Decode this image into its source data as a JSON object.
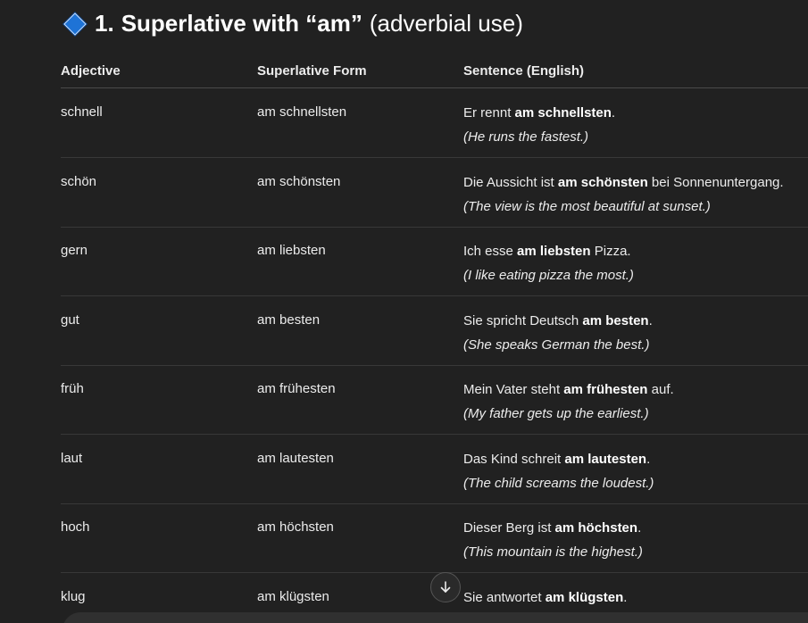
{
  "heading": {
    "number": "1.",
    "bold_text": "Superlative with “am”",
    "rest_text": "(adverbial use)",
    "icon": "blue-diamond-icon"
  },
  "columns": {
    "adjective": "Adjective",
    "superlative": "Superlative Form",
    "sentence": "Sentence (English)"
  },
  "rows": [
    {
      "adjective": "schnell",
      "superlative": "am schnellsten",
      "sentence_before": "Er rennt ",
      "sentence_bold": "am schnellsten",
      "sentence_after": ".",
      "translation": "(He runs the fastest.)"
    },
    {
      "adjective": "schön",
      "superlative": "am schönsten",
      "sentence_before": "Die Aussicht ist ",
      "sentence_bold": "am schönsten",
      "sentence_after": " bei Sonnenuntergang.",
      "translation": "(The view is the most beautiful at sunset.)"
    },
    {
      "adjective": "gern",
      "superlative": "am liebsten",
      "sentence_before": "Ich esse ",
      "sentence_bold": "am liebsten",
      "sentence_after": " Pizza.",
      "translation": "(I like eating pizza the most.)"
    },
    {
      "adjective": "gut",
      "superlative": "am besten",
      "sentence_before": "Sie spricht Deutsch ",
      "sentence_bold": "am besten",
      "sentence_after": ".",
      "translation": "(She speaks German the best.)"
    },
    {
      "adjective": "früh",
      "superlative": "am frühesten",
      "sentence_before": "Mein Vater steht ",
      "sentence_bold": "am frühesten",
      "sentence_after": " auf.",
      "translation": "(My father gets up the earliest.)"
    },
    {
      "adjective": "laut",
      "superlative": "am lautesten",
      "sentence_before": "Das Kind schreit ",
      "sentence_bold": "am lautesten",
      "sentence_after": ".",
      "translation": "(The child screams the loudest.)"
    },
    {
      "adjective": "hoch",
      "superlative": "am höchsten",
      "sentence_before": "Dieser Berg ist ",
      "sentence_bold": "am höchsten",
      "sentence_after": ".",
      "translation": "(This mountain is the highest.)"
    },
    {
      "adjective": "klug",
      "superlative": "am klügsten",
      "sentence_before": "Sie antwortet ",
      "sentence_bold": "am klügsten",
      "sentence_after": ".",
      "translation": ""
    }
  ],
  "scroll_button": {
    "icon": "arrow-down-icon"
  },
  "colors": {
    "background": "#212121",
    "text": "#ececec",
    "diamond": "#1e73d6",
    "divider": "#383838"
  }
}
